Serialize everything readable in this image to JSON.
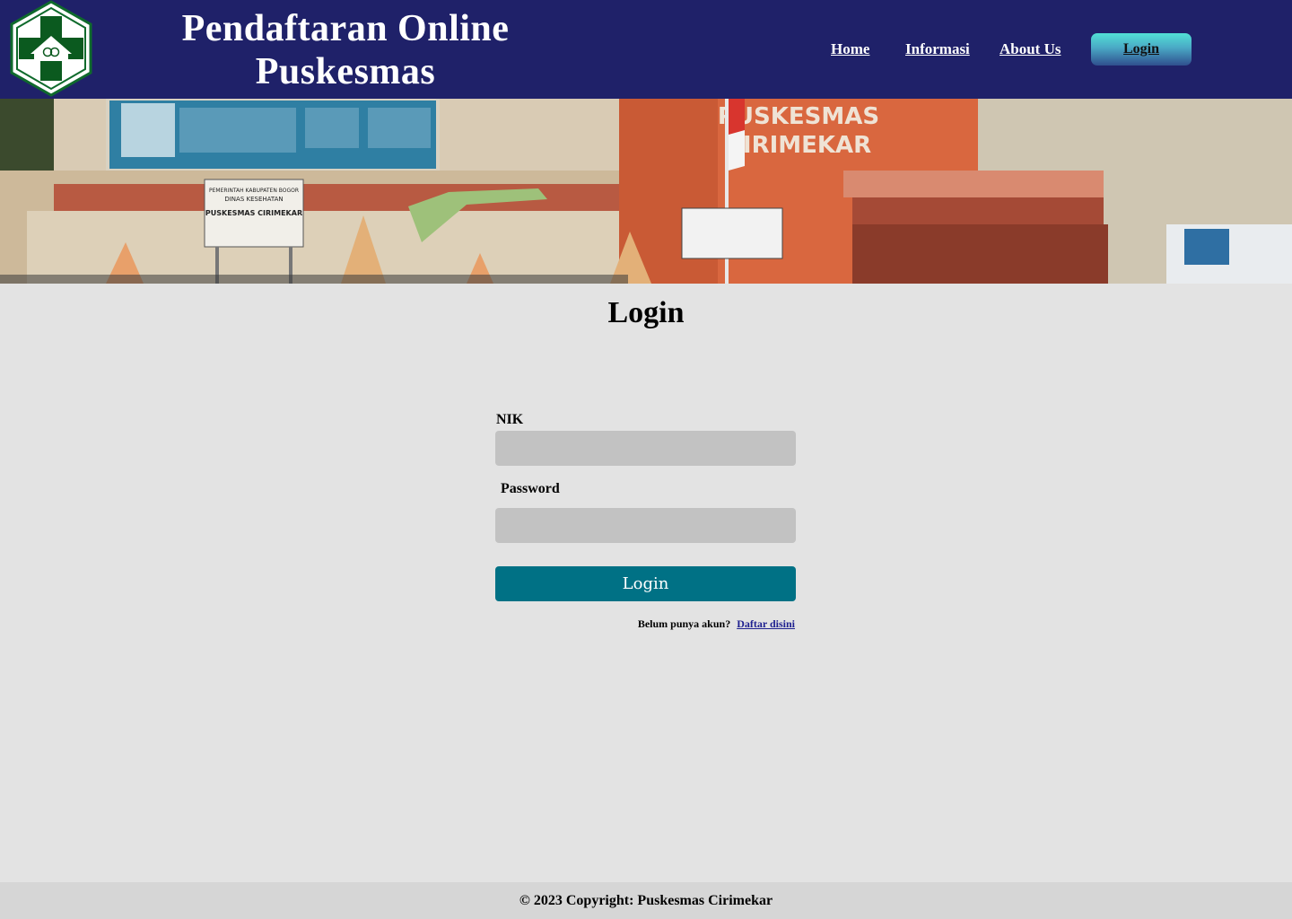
{
  "header": {
    "title_line1": "Pendaftaran Online",
    "title_line2": "Puskesmas",
    "nav": {
      "home": "Home",
      "informasi": "Informasi",
      "about": "About Us",
      "login": "Login"
    },
    "background_color": "#1f2169",
    "logo_icon": "puskesmas-logo-icon"
  },
  "banner": {
    "sign_line1": "PUSKESMAS",
    "sign_line2": "CIRIMEKAR",
    "board_line1": "PEMERINTAH KABUPATEN BOGOR",
    "board_line2": "DINAS KESEHATAN",
    "board_line3": "PUSKESMAS CIRIMEKAR"
  },
  "login_form": {
    "heading": "Login",
    "nik_label": "NIK",
    "nik_value": "",
    "password_label": "Password",
    "password_value": "",
    "submit_label": "Login",
    "register_prompt": "Belum punya akun?",
    "register_link": "Daftar disini",
    "submit_color": "#007185"
  },
  "footer": {
    "copyright": "© 2023 Copyright: Puskesmas Cirimekar"
  }
}
